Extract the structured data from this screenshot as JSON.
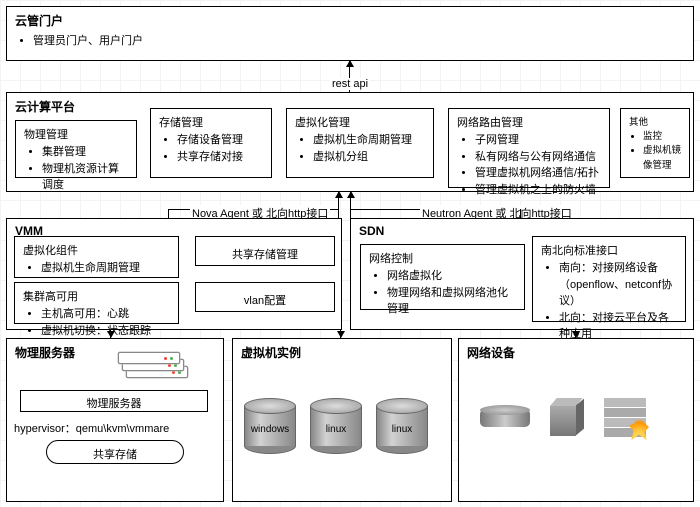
{
  "portal": {
    "title": "云管门户",
    "desc": "管理员门户、用户门户"
  },
  "restapi": "rest api",
  "cloud": {
    "title": "云计算平台",
    "phys": {
      "title": "物理管理",
      "items": [
        "集群管理",
        "物理机资源计算调度"
      ]
    },
    "store": {
      "title": "存储管理",
      "items": [
        "存储设备管理",
        "共享存储对接"
      ]
    },
    "virt": {
      "title": "虚拟化管理",
      "items": [
        "虚拟机生命周期管理",
        "虚拟机分组"
      ]
    },
    "net": {
      "title": "网络路由管理",
      "items": [
        "子网管理",
        "私有网络与公有网络通信",
        "管理虚拟机网络通信/拓扑",
        "管理虚拟机之上的防火墙"
      ]
    },
    "other": {
      "title": "其他",
      "items": [
        "监控",
        "虚拟机镜像管理"
      ]
    }
  },
  "agents": {
    "a1": "Nova Agent   或 北向http接口",
    "a2": "Neutron Agent   或 北向http接口"
  },
  "vmm": {
    "title": "VMM",
    "comp": {
      "title": "虚拟化组件",
      "items": [
        "虚拟机生命周期管理"
      ]
    },
    "ss": "共享存储管理",
    "ha": {
      "title": "集群高可用",
      "items": [
        "主机高可用：心跳",
        "虚拟机切换：状态跟踪"
      ]
    },
    "vlan": "vlan配置"
  },
  "sdn": {
    "title": "SDN",
    "ctrl": {
      "title": "网络控制",
      "items": [
        "网络虚拟化",
        "物理网络和虚拟网络池化管理"
      ]
    },
    "nb": {
      "title": "南北向标准接口",
      "items": [
        "南向：对接网络设备（openflow、netconf协议）",
        "北向：对接云平台及各种应用"
      ]
    }
  },
  "physsrv": {
    "title": "物理服务器",
    "server": "物理服务器",
    "hypervisor": "hypervisor：qemu\\kvm\\vmmare",
    "shared": "共享存储"
  },
  "vminst": {
    "title": "虚拟机实例",
    "vms": [
      "windows",
      "linux",
      "linux"
    ]
  },
  "netdev": {
    "title": "网络设备"
  }
}
